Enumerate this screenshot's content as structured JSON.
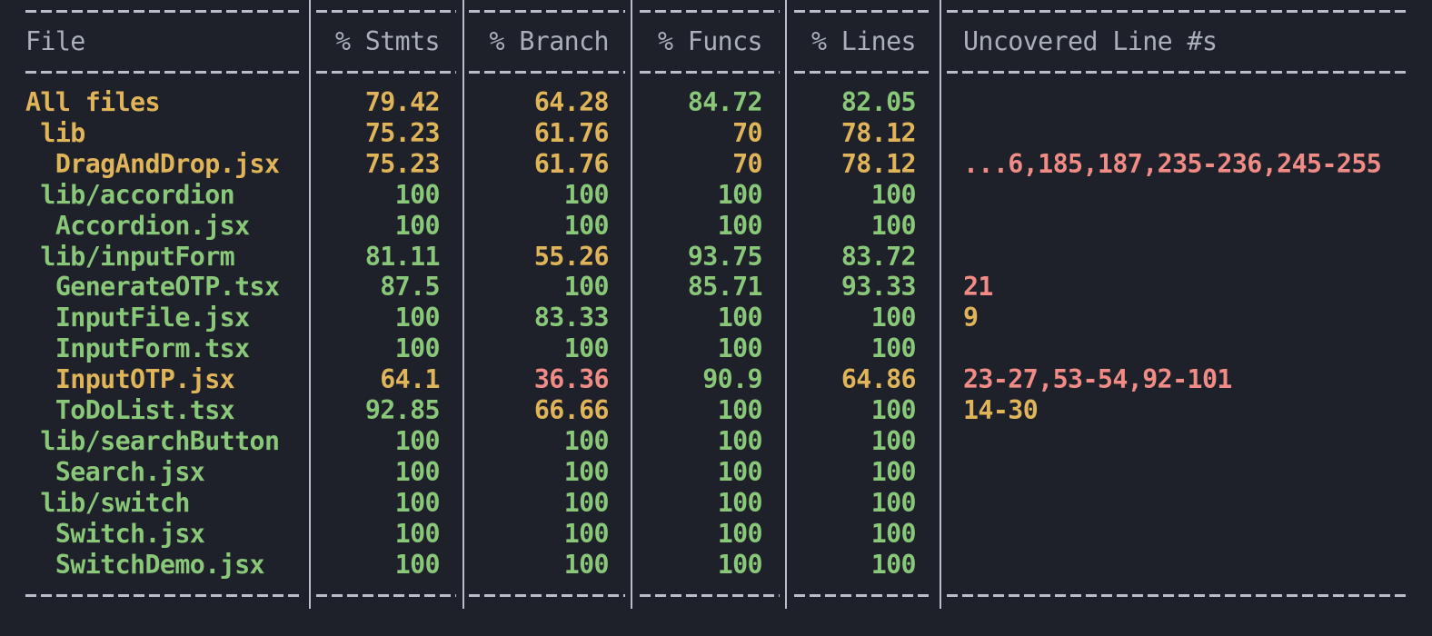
{
  "table": {
    "headers": {
      "file": "File",
      "stmts": "% Stmts",
      "branch": "% Branch",
      "funcs": "% Funcs",
      "lines": "% Lines",
      "uncovered": "Uncovered Line #s"
    },
    "rows": [
      {
        "file": "All files",
        "indent": 0,
        "file_color": "yellow",
        "stmts": "79.42",
        "stmts_color": "yellow",
        "branch": "64.28",
        "branch_color": "yellow",
        "funcs": "84.72",
        "funcs_color": "green",
        "lines": "82.05",
        "lines_color": "green",
        "uncovered": "",
        "uncovered_color": "green"
      },
      {
        "file": "lib",
        "indent": 1,
        "file_color": "yellow",
        "stmts": "75.23",
        "stmts_color": "yellow",
        "branch": "61.76",
        "branch_color": "yellow",
        "funcs": "70",
        "funcs_color": "yellow",
        "lines": "78.12",
        "lines_color": "yellow",
        "uncovered": "",
        "uncovered_color": "green"
      },
      {
        "file": "DragAndDrop.jsx",
        "indent": 2,
        "file_color": "yellow",
        "stmts": "75.23",
        "stmts_color": "yellow",
        "branch": "61.76",
        "branch_color": "yellow",
        "funcs": "70",
        "funcs_color": "yellow",
        "lines": "78.12",
        "lines_color": "yellow",
        "uncovered": "...6,185,187,235-236,245-255",
        "uncovered_color": "red"
      },
      {
        "file": "lib/accordion",
        "indent": 1,
        "file_color": "green",
        "stmts": "100",
        "stmts_color": "green",
        "branch": "100",
        "branch_color": "green",
        "funcs": "100",
        "funcs_color": "green",
        "lines": "100",
        "lines_color": "green",
        "uncovered": "",
        "uncovered_color": "green"
      },
      {
        "file": "Accordion.jsx",
        "indent": 2,
        "file_color": "green",
        "stmts": "100",
        "stmts_color": "green",
        "branch": "100",
        "branch_color": "green",
        "funcs": "100",
        "funcs_color": "green",
        "lines": "100",
        "lines_color": "green",
        "uncovered": "",
        "uncovered_color": "green"
      },
      {
        "file": "lib/inputForm",
        "indent": 1,
        "file_color": "green",
        "stmts": "81.11",
        "stmts_color": "green",
        "branch": "55.26",
        "branch_color": "yellow",
        "funcs": "93.75",
        "funcs_color": "green",
        "lines": "83.72",
        "lines_color": "green",
        "uncovered": "",
        "uncovered_color": "green"
      },
      {
        "file": "GenerateOTP.tsx",
        "indent": 2,
        "file_color": "green",
        "stmts": "87.5",
        "stmts_color": "green",
        "branch": "100",
        "branch_color": "green",
        "funcs": "85.71",
        "funcs_color": "green",
        "lines": "93.33",
        "lines_color": "green",
        "uncovered": "21",
        "uncovered_color": "red"
      },
      {
        "file": "InputFile.jsx",
        "indent": 2,
        "file_color": "green",
        "stmts": "100",
        "stmts_color": "green",
        "branch": "83.33",
        "branch_color": "green",
        "funcs": "100",
        "funcs_color": "green",
        "lines": "100",
        "lines_color": "green",
        "uncovered": "9",
        "uncovered_color": "yellow"
      },
      {
        "file": "InputForm.tsx",
        "indent": 2,
        "file_color": "green",
        "stmts": "100",
        "stmts_color": "green",
        "branch": "100",
        "branch_color": "green",
        "funcs": "100",
        "funcs_color": "green",
        "lines": "100",
        "lines_color": "green",
        "uncovered": "",
        "uncovered_color": "green"
      },
      {
        "file": "InputOTP.jsx",
        "indent": 2,
        "file_color": "yellow",
        "stmts": "64.1",
        "stmts_color": "yellow",
        "branch": "36.36",
        "branch_color": "red",
        "funcs": "90.9",
        "funcs_color": "green",
        "lines": "64.86",
        "lines_color": "yellow",
        "uncovered": "23-27,53-54,92-101",
        "uncovered_color": "red"
      },
      {
        "file": "ToDoList.tsx",
        "indent": 2,
        "file_color": "green",
        "stmts": "92.85",
        "stmts_color": "green",
        "branch": "66.66",
        "branch_color": "yellow",
        "funcs": "100",
        "funcs_color": "green",
        "lines": "100",
        "lines_color": "green",
        "uncovered": "14-30",
        "uncovered_color": "yellow"
      },
      {
        "file": "lib/searchButton",
        "indent": 1,
        "file_color": "green",
        "stmts": "100",
        "stmts_color": "green",
        "branch": "100",
        "branch_color": "green",
        "funcs": "100",
        "funcs_color": "green",
        "lines": "100",
        "lines_color": "green",
        "uncovered": "",
        "uncovered_color": "green"
      },
      {
        "file": "Search.jsx",
        "indent": 2,
        "file_color": "green",
        "stmts": "100",
        "stmts_color": "green",
        "branch": "100",
        "branch_color": "green",
        "funcs": "100",
        "funcs_color": "green",
        "lines": "100",
        "lines_color": "green",
        "uncovered": "",
        "uncovered_color": "green"
      },
      {
        "file": "lib/switch",
        "indent": 1,
        "file_color": "green",
        "stmts": "100",
        "stmts_color": "green",
        "branch": "100",
        "branch_color": "green",
        "funcs": "100",
        "funcs_color": "green",
        "lines": "100",
        "lines_color": "green",
        "uncovered": "",
        "uncovered_color": "green"
      },
      {
        "file": "Switch.jsx",
        "indent": 2,
        "file_color": "green",
        "stmts": "100",
        "stmts_color": "green",
        "branch": "100",
        "branch_color": "green",
        "funcs": "100",
        "funcs_color": "green",
        "lines": "100",
        "lines_color": "green",
        "uncovered": "",
        "uncovered_color": "green"
      },
      {
        "file": "SwitchDemo.jsx",
        "indent": 2,
        "file_color": "green",
        "stmts": "100",
        "stmts_color": "green",
        "branch": "100",
        "branch_color": "green",
        "funcs": "100",
        "funcs_color": "green",
        "lines": "100",
        "lines_color": "green",
        "uncovered": "",
        "uncovered_color": "green"
      }
    ]
  },
  "colors": {
    "background": "#1e2129",
    "green": "#89c779",
    "yellow": "#e0b55a",
    "red": "#f08b86",
    "header": "#a9b0bb",
    "border": "#b9bfc9"
  }
}
